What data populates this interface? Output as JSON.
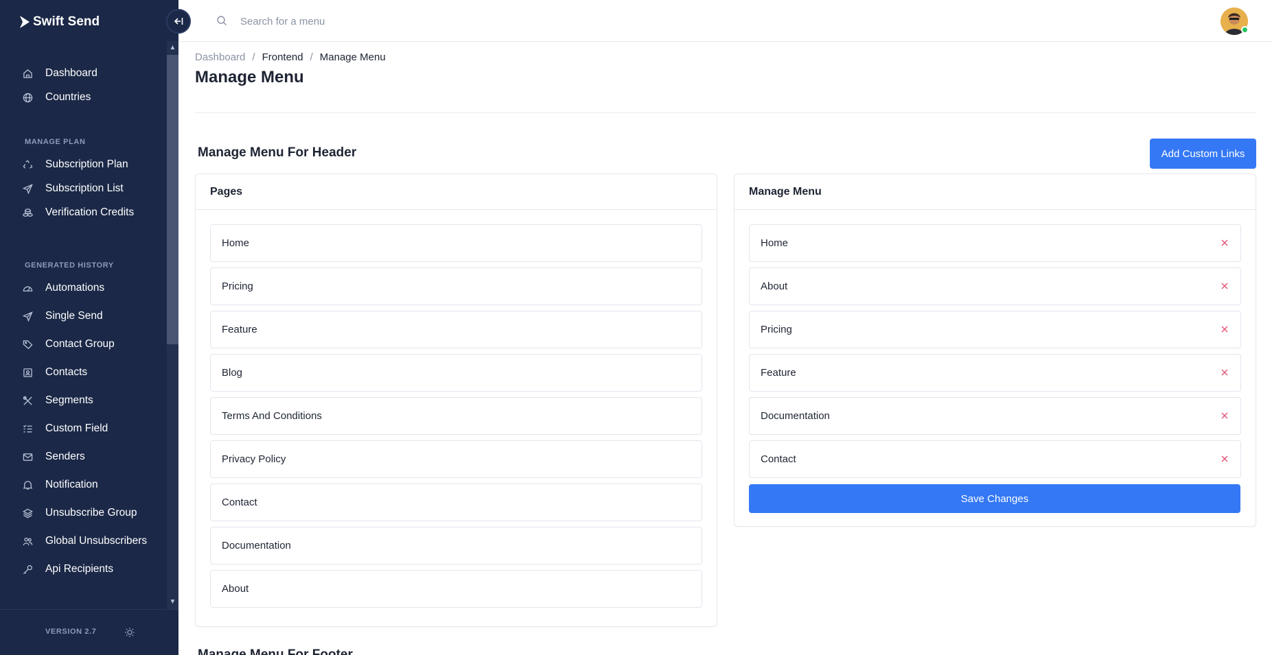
{
  "brand": {
    "name": "Swift Send"
  },
  "sidebar": {
    "items_top": [
      {
        "label": "Dashboard",
        "icon": "home-icon"
      },
      {
        "label": "Countries",
        "icon": "globe-icon"
      }
    ],
    "section_plan": "MANAGE PLAN",
    "items_plan": [
      {
        "label": "Subscription Plan",
        "icon": "recycle-icon"
      },
      {
        "label": "Subscription List",
        "icon": "paper-plane-icon"
      },
      {
        "label": "Verification Credits",
        "icon": "coins-icon"
      }
    ],
    "section_history": "GENERATED HISTORY",
    "items_history": [
      {
        "label": "Automations",
        "icon": "gauge-icon"
      },
      {
        "label": "Single Send",
        "icon": "paper-plane-icon"
      },
      {
        "label": "Contact Group",
        "icon": "tags-icon"
      },
      {
        "label": "Contacts",
        "icon": "contact-card-icon"
      },
      {
        "label": "Segments",
        "icon": "tools-icon"
      },
      {
        "label": "Custom Field",
        "icon": "list-check-icon"
      },
      {
        "label": "Senders",
        "icon": "mail-icon"
      },
      {
        "label": "Notification",
        "icon": "bell-icon"
      },
      {
        "label": "Unsubscribe Group",
        "icon": "layers-icon"
      },
      {
        "label": "Global Unsubscribers",
        "icon": "users-icon"
      },
      {
        "label": "Api Recipients",
        "icon": "key-icon"
      }
    ],
    "version": "VERSION 2.7"
  },
  "topbar": {
    "search_placeholder": "Search for a menu"
  },
  "breadcrumb": {
    "items": [
      "Dashboard",
      "Frontend",
      "Manage Menu"
    ]
  },
  "page": {
    "title": "Manage Menu",
    "section_title": "Manage Menu For Header",
    "add_button": "Add Custom Links",
    "next_section_title": "Manage Menu For Footer"
  },
  "pages_card": {
    "title": "Pages",
    "items": [
      "Home",
      "Pricing",
      "Feature",
      "Blog",
      "Terms And Conditions",
      "Privacy Policy",
      "Contact",
      "Documentation",
      "About"
    ]
  },
  "menu_card": {
    "title": "Manage Menu",
    "items": [
      "Home",
      "About",
      "Pricing",
      "Feature",
      "Documentation",
      "Contact"
    ],
    "save_button": "Save Changes"
  },
  "colors": {
    "sidebar_bg": "#1b2847",
    "primary": "#3478f6",
    "remove": "#e4577a"
  }
}
